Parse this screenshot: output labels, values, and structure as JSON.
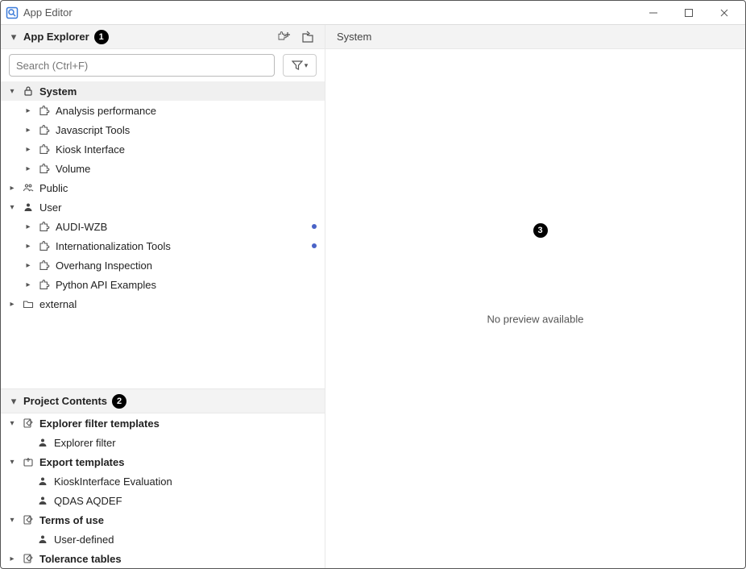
{
  "window": {
    "title": "App Editor"
  },
  "appExplorer": {
    "label": "App Explorer",
    "callout": "1",
    "search": {
      "placeholder": "Search (Ctrl+F)"
    },
    "tree": {
      "system": {
        "label": "System"
      },
      "system_children": {
        "analysis": "Analysis performance",
        "js": "Javascript Tools",
        "kiosk": "Kiosk Interface",
        "volume": "Volume"
      },
      "public": {
        "label": "Public"
      },
      "user": {
        "label": "User"
      },
      "user_children": {
        "audi": "AUDI-WZB",
        "i18n": "Internationalization Tools",
        "overhang": "Overhang Inspection",
        "python": "Python API Examples"
      },
      "external": {
        "label": "external"
      }
    }
  },
  "projectContents": {
    "label": "Project Contents",
    "callout": "2",
    "groups": {
      "filter_templates": {
        "label": "Explorer filter templates"
      },
      "filter_templates_items": {
        "explorer_filter": "Explorer filter"
      },
      "export_templates": {
        "label": "Export templates"
      },
      "export_templates_items": {
        "kiosk": "KioskInterface Evaluation",
        "qdas": "QDAS AQDEF"
      },
      "terms_of_use": {
        "label": "Terms of use"
      },
      "terms_of_use_items": {
        "user_defined": "User-defined"
      },
      "tolerance_tables": {
        "label": "Tolerance tables"
      }
    }
  },
  "preview": {
    "title": "System",
    "message": "No preview available",
    "callout": "3"
  }
}
